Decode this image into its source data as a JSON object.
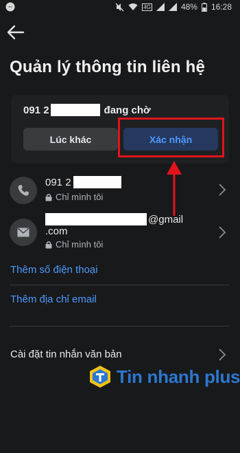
{
  "status_bar": {
    "battery": "48%",
    "time": "16:28",
    "network": "4G"
  },
  "header": {
    "title": "Quản lý thông tin liên hệ"
  },
  "pending": {
    "number_prefix": "091 2",
    "status": "đang chờ",
    "later_label": "Lúc khác",
    "confirm_label": "Xác nhận"
  },
  "contacts": [
    {
      "icon": "phone-icon",
      "value_prefix": "091 2",
      "privacy": "Chỉ mình tôi"
    },
    {
      "icon": "mail-icon",
      "value_suffix": "@gmail",
      "value_line2": ".com",
      "privacy": "Chỉ mình tôi"
    }
  ],
  "links": {
    "add_phone": "Thêm số điện thoại",
    "add_email": "Thêm địa chỉ email"
  },
  "settings": {
    "sms_label": "Cài đặt tin nhắn văn bản"
  },
  "watermark": {
    "text": "Tin nhanh plus"
  },
  "colors": {
    "background": "#18191a",
    "accent": "#4d9bff",
    "highlight": "#e0141d"
  }
}
